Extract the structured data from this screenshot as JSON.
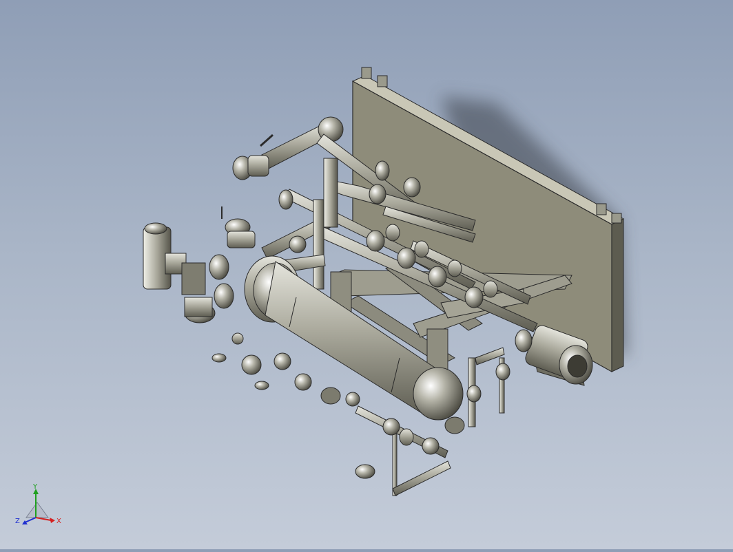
{
  "view": {
    "background_top": "#8f9eb6",
    "background_bottom": "#c4ccd9",
    "model_color": "#9a9a8c",
    "edge_color": "#2b2b2b"
  },
  "model": {
    "name": "skid assembly",
    "parts": [
      "mounting-plate",
      "vessel",
      "pump-motor",
      "gearbox",
      "pipework",
      "ball-valves",
      "support-frame"
    ]
  },
  "triad": {
    "x_label": "X",
    "y_label": "Y",
    "z_label": "Z",
    "x_color": "#d42020",
    "y_color": "#1fa01f",
    "z_color": "#2030d0"
  }
}
